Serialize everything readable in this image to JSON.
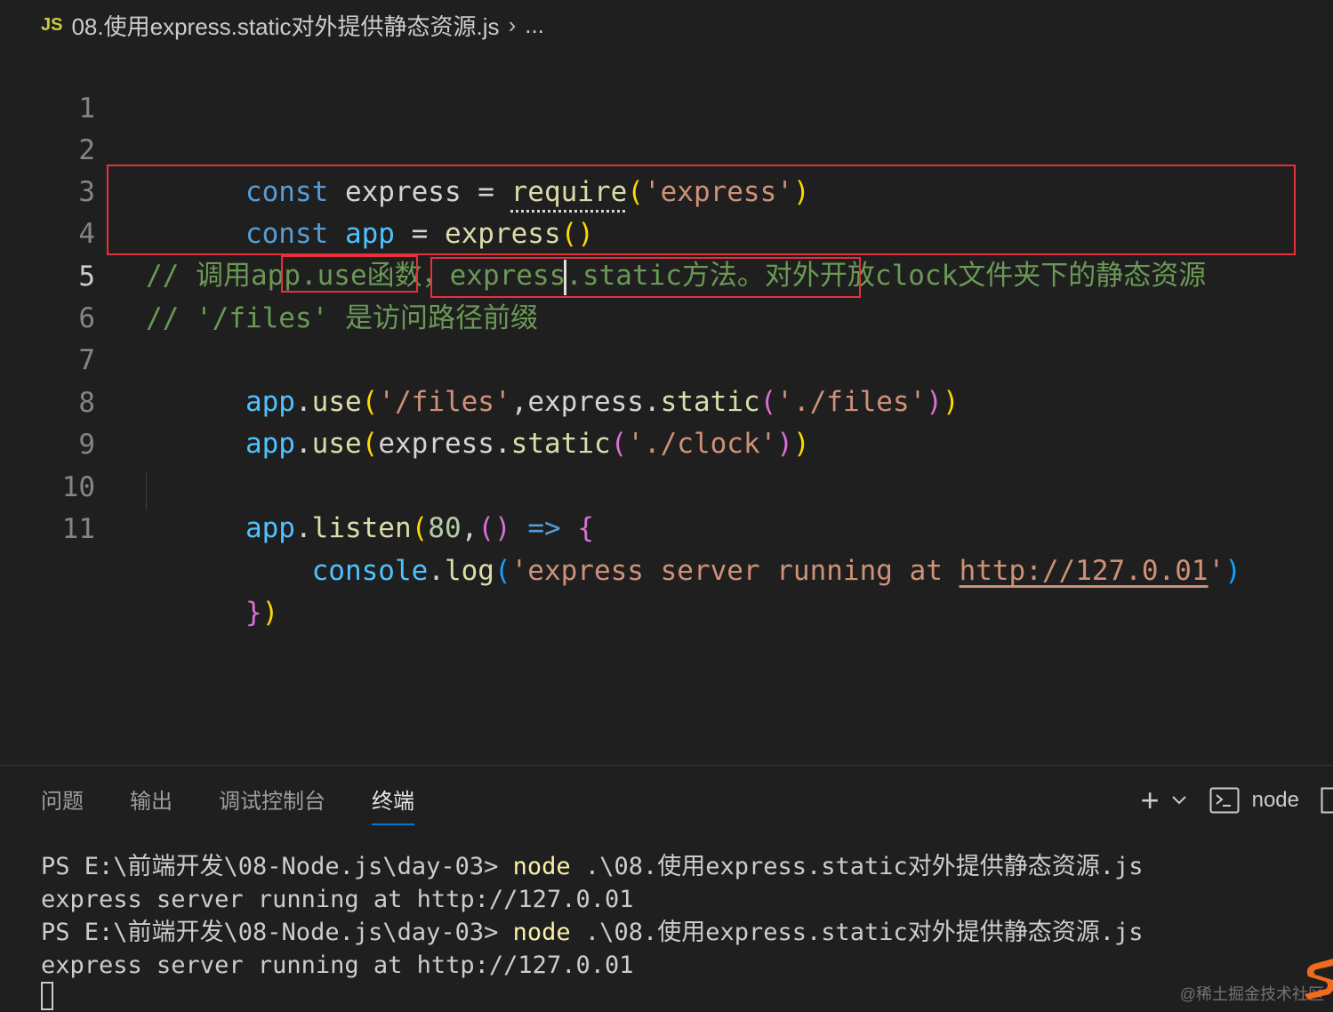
{
  "breadcrumb": {
    "badge": "JS",
    "file": "08.使用express.static对外提供静态资源.js",
    "separator": "›",
    "ellipsis": "..."
  },
  "editor": {
    "line_numbers": [
      "1",
      "2",
      "3",
      "4",
      "5",
      "6",
      "7",
      "8",
      "9",
      "10",
      "11"
    ],
    "active_line": "5",
    "lines": {
      "l1": {
        "kw": "const",
        "name": " express ",
        "eq": "= ",
        "fn": "require",
        "open": "(",
        "str": "'express'",
        "close": ")"
      },
      "l2": {
        "kw": "const",
        "sp": " ",
        "name": "app",
        "eq": " = ",
        "fn": "express",
        "parens": "()"
      },
      "l4": {
        "comment": "// 调用app.use函数，express.static方法。对外开放clock文件夹下的静态资源"
      },
      "l5": {
        "comment": "// '/files' 是访问路径前缀"
      },
      "l6": {
        "obj": "app",
        "dot": ".",
        "fn": "use",
        "open": "(",
        "str1": "'/files'",
        "comma": ",",
        "obj2": "express",
        "dot2": ".",
        "fn2": "static",
        "open2": "(",
        "str2": "'./files'",
        "close2": ")",
        "close": ")"
      },
      "l7": {
        "obj": "app",
        "dot": ".",
        "fn": "use",
        "open": "(",
        "obj2": "express",
        "dot2": ".",
        "fn2": "static",
        "open2": "(",
        "str": "'./clock'",
        "close2": ")",
        "close": ")"
      },
      "l9": {
        "obj": "app",
        "dot": ".",
        "fn": "listen",
        "open": "(",
        "num": "80",
        "comma": ",",
        "arrow_open": "(",
        "arrow_close": ")",
        "arrow": " => ",
        "brace": "{"
      },
      "l10": {
        "indent": "    ",
        "obj": "console",
        "dot": ".",
        "fn": "log",
        "open": "(",
        "str_start": "'express server running at ",
        "url": "http://127.0.01",
        "str_end": "'",
        "close": ")"
      },
      "l11": {
        "brace": "}",
        "close": ")"
      }
    }
  },
  "panel": {
    "tabs": [
      "问题",
      "输出",
      "调试控制台",
      "终端"
    ],
    "active_tab": "终端",
    "tools": {
      "add": "+",
      "chevron": "⌵",
      "terminal_name": "node"
    }
  },
  "terminal": {
    "prompt1": "PS E:\\前端开发\\08-Node.js\\day-03> ",
    "cmd1": "node",
    "arg1": " .\\08.使用express.static对外提供静态资源.js",
    "out1": "express server running at http://127.0.01",
    "prompt2": "PS E:\\前端开发\\08-Node.js\\day-03> ",
    "cmd2": "node",
    "arg2": " .\\08.使用express.static对外提供静态资源.js",
    "out2": "express server running at http://127.0.01"
  },
  "watermark": "@稀土掘金技术社区",
  "colors": {
    "background": "#1f1f1f",
    "highlight_box": "#e8303b",
    "active_tab_underline": "#0078d4"
  }
}
